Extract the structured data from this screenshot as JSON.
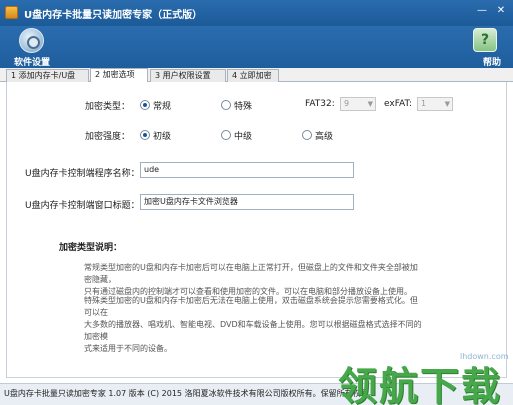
{
  "window": {
    "title": "U盘内存卡批量只读加密专家（正式版）",
    "minimize_icon": "minimize-icon",
    "close_icon": "close-icon"
  },
  "toolbar": {
    "settings_label": "软件设置",
    "settings_icon": "gear-icon",
    "help_label": "帮助",
    "help_icon": "question-icon"
  },
  "tabs": [
    {
      "label": "1 添加内存卡/U盘"
    },
    {
      "label": "2 加密选项",
      "active": true
    },
    {
      "label": "3 用户权限设置"
    },
    {
      "label": "4 立即加密"
    }
  ],
  "options": {
    "encrypt_type": {
      "label": "加密类型：",
      "choices": [
        {
          "label": "常规",
          "checked": true
        },
        {
          "label": "特殊",
          "checked": false
        }
      ],
      "fat32_label": "FAT32:",
      "fat32_value": "9",
      "exfat_label": "exFAT:",
      "exfat_value": "1"
    },
    "encrypt_strength": {
      "label": "加密强度：",
      "choices": [
        {
          "label": "初级",
          "checked": true
        },
        {
          "label": "中级",
          "checked": false
        },
        {
          "label": "高级",
          "checked": false
        }
      ]
    },
    "program_name": {
      "label": "U盘内存卡控制端程序名称：",
      "value": "ude"
    },
    "window_title": {
      "label": "U盘内存卡控制端窗口标题：",
      "value": "加密U盘内存卡文件浏览器"
    }
  },
  "description": {
    "title": "加密类型说明：",
    "paragraphs": [
      [
        "常规类型加密的U盘和内存卡加密后可以在电脑上正常打开，但磁盘上的文件和文件夹全部被加密隐藏，",
        "只有通过磁盘内的控制端才可以查看和使用加密的文件。可以在电脑和部分播放设备上使用。"
      ],
      [
        "特殊类型加密的U盘和内存卡加密后无法在电脑上使用，双击磁盘系统会提示您需要格式化。但可以在",
        "大多数的播放器、唱戏机、智能电视、DVD和车载设备上使用。您可以根据磁盘格式选择不同的加密模",
        "式来适用于不同的设备。"
      ]
    ]
  },
  "status": {
    "text": "U盘内存卡批量只读加密专家 1.07 版本 (C) 2015 洛阳夏冰软件技术有限公司版权所有。保留所有权利。"
  },
  "watermark": {
    "text": "领航下载",
    "site": "lhdown.com"
  }
}
